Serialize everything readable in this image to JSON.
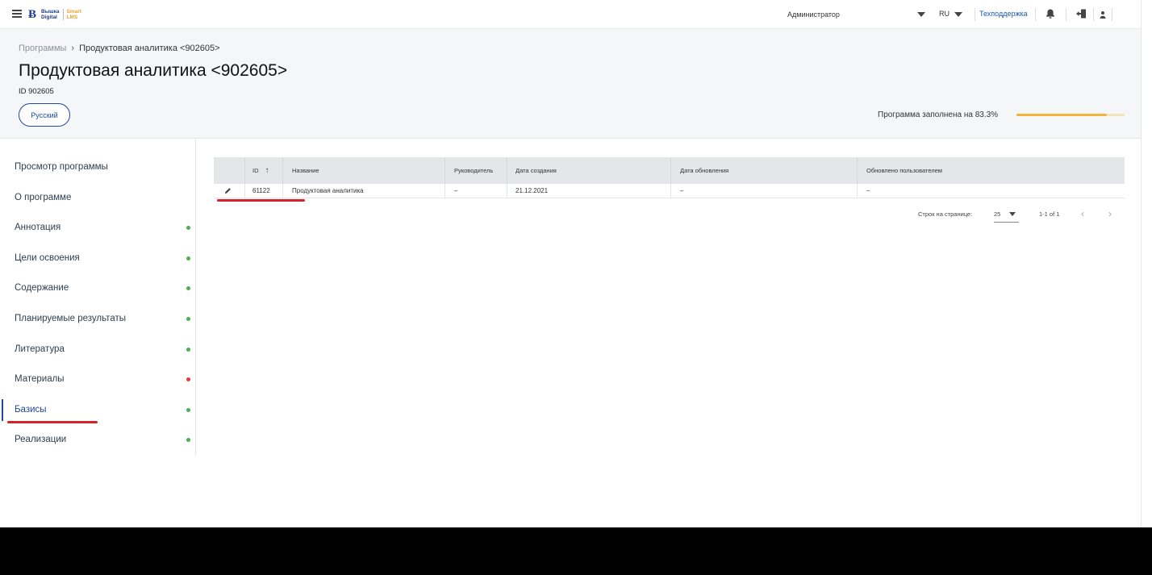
{
  "topbar": {
    "logo_line1": "Вышка",
    "logo_line2": "Digital",
    "logo_smart1": "Smart",
    "logo_smart2": "LMS",
    "role": "Администратор",
    "lang": "RU",
    "support": "Техподдержка"
  },
  "breadcrumb": {
    "parent": "Программы",
    "current": "Продуктовая аналитика <902605>"
  },
  "header": {
    "title": "Продуктовая аналитика <902605>",
    "id_label": "ID 902605",
    "language": "Русский",
    "progress_label": "Программа заполнена на 83.3%",
    "progress_fraction": 0.833
  },
  "sidebar": {
    "items": [
      {
        "label": "Просмотр программы",
        "status": null
      },
      {
        "label": "О программе",
        "status": null
      },
      {
        "label": "Аннотация",
        "status": "#4caf50"
      },
      {
        "label": "Цели освоения",
        "status": "#4caf50"
      },
      {
        "label": "Содержание",
        "status": "#4caf50"
      },
      {
        "label": "Планируемые результаты",
        "status": "#4caf50"
      },
      {
        "label": "Литература",
        "status": "#4caf50"
      },
      {
        "label": "Материалы",
        "status": "#e53935"
      },
      {
        "label": "Базисы",
        "status": "#4caf50"
      },
      {
        "label": "Реализации",
        "status": "#4caf50"
      }
    ],
    "active_index": 8
  },
  "table": {
    "columns": [
      "ID",
      "Название",
      "Руководитель",
      "Дата создания",
      "Дата обновления",
      "Обновлено пользователем"
    ],
    "rows": [
      {
        "id": "61122",
        "name": "Продуктовая аналитика",
        "manager": "–",
        "created": "21.12.2021",
        "updated": "–",
        "updated_by": "–"
      }
    ]
  },
  "pager": {
    "label": "Строк на странице:",
    "per_page": "25",
    "range": "1-1 of 1"
  },
  "colors": {
    "accent": "#1e4ba0",
    "progress": "#f0b43a",
    "annotation_red": "#d2232a"
  }
}
